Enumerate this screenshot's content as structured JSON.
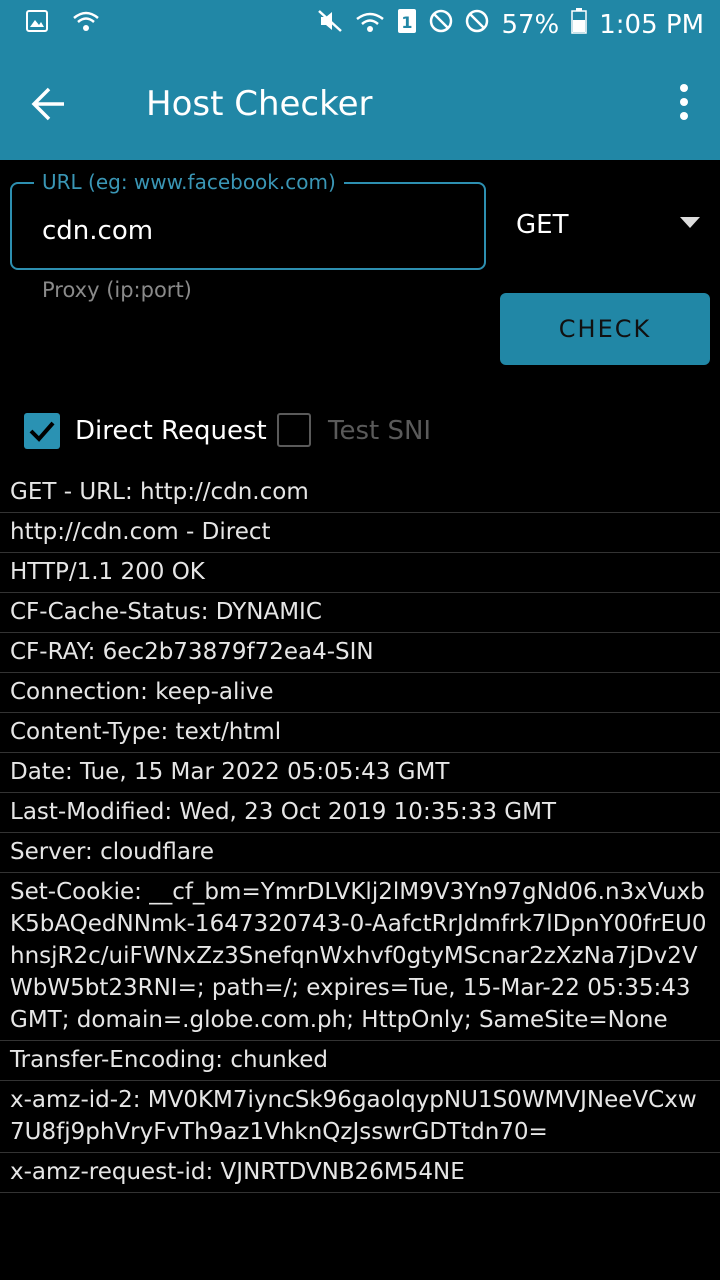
{
  "status_bar": {
    "battery": "57%",
    "time": "1:05 PM",
    "icons": [
      "gallery-icon",
      "wifi-question-icon",
      "mute-icon",
      "wifi-icon",
      "sim-1-icon",
      "block-icon",
      "block-icon",
      "battery-icon"
    ]
  },
  "toolbar": {
    "title": "Host Checker"
  },
  "form": {
    "url_legend": "URL (eg: www.facebook.com)",
    "url_value": "cdn.com",
    "proxy_placeholder": "Proxy (ip:port)",
    "method": "GET",
    "check_label": "CHECK",
    "direct_request_label": "Direct Request",
    "direct_request_checked": true,
    "test_sni_label": "Test SNI",
    "test_sni_checked": false
  },
  "results": [
    "GET - URL: http://cdn.com",
    "http://cdn.com - Direct",
    "HTTP/1.1 200 OK",
    "CF-Cache-Status: DYNAMIC",
    "CF-RAY: 6ec2b73879f72ea4-SIN",
    "Connection: keep-alive",
    "Content-Type: text/html",
    "Date: Tue, 15 Mar 2022 05:05:43 GMT",
    "Last-Modified: Wed, 23 Oct 2019 10:35:33 GMT",
    "Server: cloudflare",
    "Set-Cookie: __cf_bm=YmrDLVKlj2lM9V3Yn97gNd06.n3xVuxbK5bAQedNNmk-1647320743-0-AafctRrJdmfrk7lDpnY00frEU0hnsjR2c/uiFWNxZz3SnefqnWxhvf0gtyMScnar2zXzNa7jDv2VWbW5bt23RNI=; path=/; expires=Tue, 15-Mar-22 05:35:43 GMT; domain=.globe.com.ph; HttpOnly; SameSite=None",
    "Transfer-Encoding: chunked",
    "x-amz-id-2: MV0KM7iyncSk96gaolqypNU1S0WMVJNeeVCxw7U8fj9phVryFvTh9az1VhknQzJsswrGDTtdn70=",
    "x-amz-request-id: VJNRTDVNB26M54NE"
  ]
}
